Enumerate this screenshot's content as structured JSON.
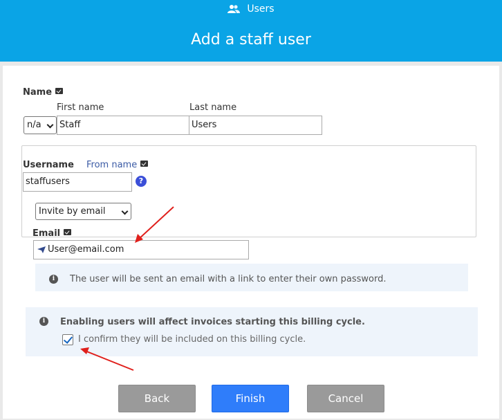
{
  "header": {
    "breadcrumb": "Users",
    "title": "Add a staff user"
  },
  "name_section": {
    "label": "Name",
    "first_name_label": "First name",
    "last_name_label": "Last name",
    "title_select_value": "n/a",
    "first_name_value": "Staff",
    "last_name_value": "Users"
  },
  "username_section": {
    "label": "Username",
    "from_name_label": "From name",
    "username_value": "staffusers",
    "help_glyph": "?"
  },
  "invite": {
    "method_select_value": "Invite by email",
    "email_label": "Email",
    "email_value": "User@email.com",
    "info_text": "The user will be sent an email with a link to enter their own password."
  },
  "billing": {
    "warning_text": "Enabling users will affect invoices starting this billing cycle.",
    "confirm_text": "I confirm they will be included on this billing cycle.",
    "confirm_checked": true
  },
  "buttons": {
    "back": "Back",
    "finish": "Finish",
    "cancel": "Cancel"
  },
  "colors": {
    "header_bg": "#0aa4e6",
    "primary_button": "#2f7dfa",
    "secondary_button": "#9a9a9a",
    "annotation_arrow": "#e0201c"
  },
  "icons": {
    "breadcrumb": "users-icon",
    "help": "question-circle-icon",
    "info": "info-circle-icon",
    "send": "paper-plane-icon"
  }
}
